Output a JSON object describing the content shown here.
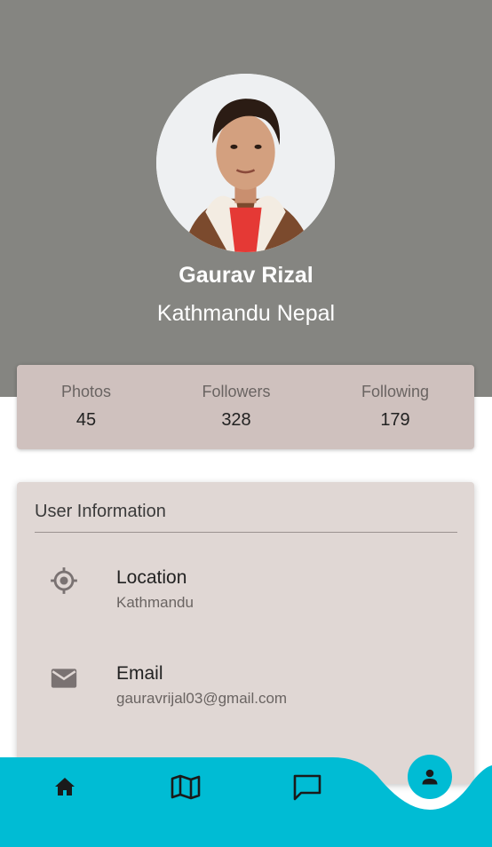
{
  "profile": {
    "name": "Gaurav Rizal",
    "location": "Kathmandu Nepal"
  },
  "stats": [
    {
      "label": "Photos",
      "value": "45"
    },
    {
      "label": "Followers",
      "value": "328"
    },
    {
      "label": "Following",
      "value": "179"
    }
  ],
  "user_info": {
    "title": "User Information",
    "rows": [
      {
        "icon": "my-location-icon",
        "label": "Location",
        "value": "Kathmandu"
      },
      {
        "icon": "email-icon",
        "label": "Email",
        "value": "gauravrijal03@gmail.com"
      }
    ]
  },
  "bottom_nav": {
    "items": [
      {
        "icon": "home-icon"
      },
      {
        "icon": "map-icon"
      },
      {
        "icon": "chat-icon"
      },
      {
        "icon": "person-icon",
        "active": true
      }
    ]
  },
  "colors": {
    "header_bg": "#858581",
    "stats_bg": "#cfc1be",
    "info_bg": "#e0d7d4",
    "nav_accent": "#00bcd4",
    "icon_grey": "#7a7272"
  }
}
